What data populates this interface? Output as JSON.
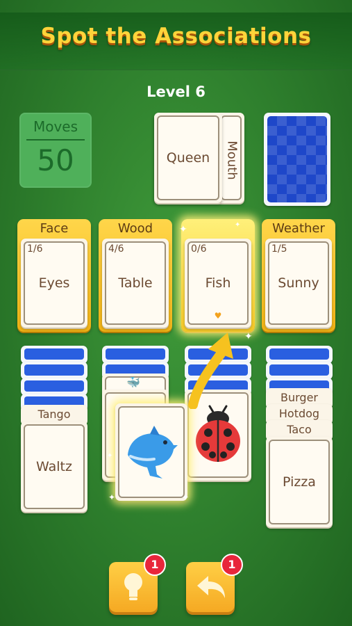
{
  "header": {
    "title": "Spot the Associations",
    "level": "Level 6"
  },
  "moves": {
    "label": "Moves",
    "value": "50"
  },
  "draw_pile": {
    "top_card": "Queen",
    "under_card": "Mouth"
  },
  "slots": [
    {
      "label": "Face",
      "count": "1/6",
      "card": "Eyes"
    },
    {
      "label": "Wood",
      "count": "4/6",
      "card": "Table"
    },
    {
      "label": "",
      "count": "0/6",
      "card": "Fish",
      "highlighted": true
    },
    {
      "label": "Weather",
      "count": "1/5",
      "card": "Sunny"
    }
  ],
  "columns": {
    "col1": {
      "strip": "Tango",
      "top": "Waltz"
    },
    "col4": {
      "strips": [
        "Burger",
        "Hotdog",
        "Taco"
      ],
      "top": "Pizza"
    }
  },
  "held_card": {
    "icon": "dolphin-icon"
  },
  "column3_card": {
    "icon": "ladybug-icon"
  },
  "buttons": {
    "hint_badge": "1",
    "undo_badge": "1"
  },
  "colors": {
    "accent": "#ffd43a",
    "card_back": "#1e47c9",
    "badge": "#e8263b"
  }
}
